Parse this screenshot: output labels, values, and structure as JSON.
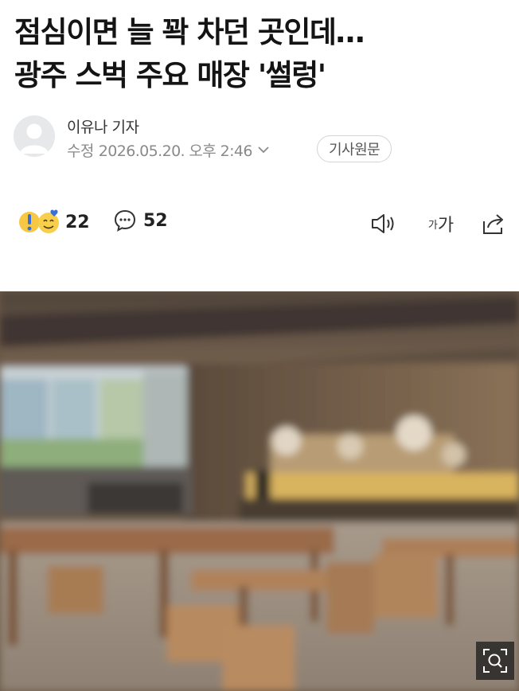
{
  "article": {
    "headline_line1": "점심이면 늘 꽉 차던 곳인데…",
    "headline_line2": "광주 스벅 주요 매장 '썰렁'",
    "reporter": "이유나 기자",
    "modified_label": "수정",
    "modified_date": "2026.05.20. 오후 2:46",
    "original_button": "기사원문"
  },
  "actions": {
    "reaction_count": "22",
    "comment_count": "52",
    "font_size_small": "가",
    "font_size_large": "가",
    "icons": [
      "reaction-emoji-icon",
      "comment-icon",
      "speaker-icon",
      "font-size-icon",
      "share-icon"
    ]
  },
  "photo": {
    "zoom_icon": "zoom-icon"
  },
  "colors": {
    "headline": "#141414",
    "meta_gray": "#8a8a8a",
    "reaction_yellow": "#f6c843",
    "reaction_blue": "#3b6fd8"
  }
}
